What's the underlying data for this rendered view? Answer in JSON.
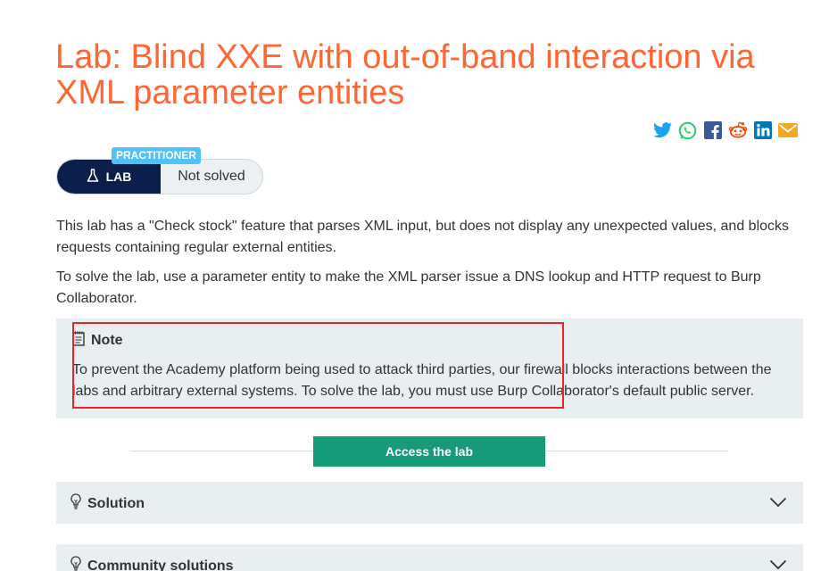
{
  "title": "Lab: Blind XXE with out-of-band interaction via XML parameter entities",
  "share": {
    "icons": [
      "twitter-icon",
      "whatsapp-icon",
      "facebook-icon",
      "reddit-icon",
      "linkedin-icon",
      "email-icon"
    ],
    "colors": {
      "twitter": "#1da1f2",
      "whatsapp": "#25d366",
      "facebook": "#3b5998",
      "reddit": "#ff4500",
      "linkedin": "#0077b5",
      "email": "#f5a623"
    }
  },
  "badge": {
    "level": "PRACTITIONER",
    "lab_label": "LAB",
    "status": "Not solved"
  },
  "description": {
    "p1": "This lab has a \"Check stock\" feature that parses XML input, but does not display any unexpected values, and blocks requests containing regular external entities.",
    "p2": "To solve the lab, use a parameter entity to make the XML parser issue a DNS lookup and HTTP request to Burp Collaborator."
  },
  "note": {
    "heading": "Note",
    "text": "To prevent the Academy platform being used to attack third parties, our firewall blocks interactions between the labs and arbitrary external systems. To solve the lab, you must use Burp Collaborator's default public server."
  },
  "access_button": "Access the lab",
  "accordions": [
    {
      "label": "Solution"
    },
    {
      "label": "Community solutions"
    }
  ],
  "colors": {
    "title": "#ff6633",
    "lab_dark": "#0a1f4a",
    "level_tag": "#4fc3f7",
    "access_button": "#169a78",
    "highlight": "#e8262a"
  }
}
